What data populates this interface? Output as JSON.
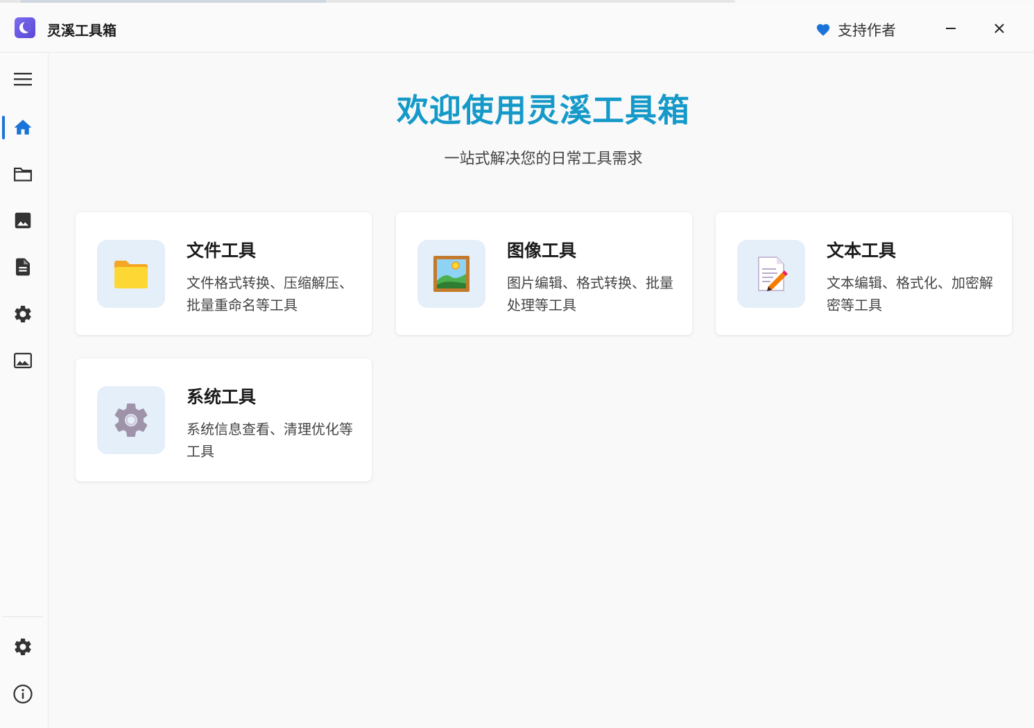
{
  "window": {
    "title": "灵溪工具箱",
    "support_label": "支持作者",
    "minimize_glyph": "—",
    "close_glyph": "✕"
  },
  "sidebar": {
    "items": [
      {
        "icon": "menu-icon",
        "active": false
      },
      {
        "icon": "home-icon",
        "active": true
      },
      {
        "icon": "folder-icon",
        "active": false
      },
      {
        "icon": "image-icon",
        "active": false
      },
      {
        "icon": "document-icon",
        "active": false
      },
      {
        "icon": "gear-icon",
        "active": false
      },
      {
        "icon": "photo-frame-icon",
        "active": false
      }
    ],
    "bottom_items": [
      {
        "icon": "settings-icon"
      },
      {
        "icon": "info-icon"
      }
    ]
  },
  "hero": {
    "title": "欢迎使用灵溪工具箱",
    "subtitle": "一站式解决您的日常工具需求"
  },
  "cards": [
    {
      "title": "文件工具",
      "desc": "文件格式转换、压缩解压、批量重命名等工具",
      "icon": "folder-icon"
    },
    {
      "title": "图像工具",
      "desc": "图片编辑、格式转换、批量处理等工具",
      "icon": "picture-icon"
    },
    {
      "title": "文本工具",
      "desc": "文本编辑、格式化、加密解密等工具",
      "icon": "memo-icon"
    },
    {
      "title": "系统工具",
      "desc": "系统信息查看、清理优化等工具",
      "icon": "gear-icon"
    }
  ],
  "colors": {
    "accent": "#1a73d9",
    "hero_title": "#1599c9",
    "card_icon_bg": "#e4effa"
  }
}
